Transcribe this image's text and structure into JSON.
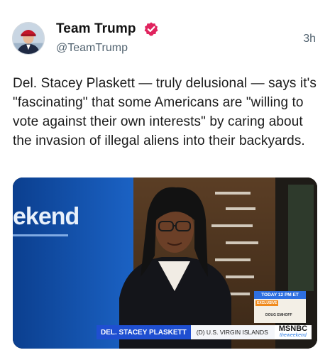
{
  "post": {
    "display_name": "Team Trump",
    "handle": "@TeamTrump",
    "timestamp": "3h",
    "body": "Del. Stacey Plaskett — truly delusional — says it's \"fascinating\" that some Americans are \"willing to vote against their own interests\" by caring about the invasion of illegal aliens into their backyards.",
    "verified_icon": "verified-badge-icon"
  },
  "media": {
    "background_wordmark": "ekend",
    "lower_third": {
      "name": "DEL. STACEY PLASKETT",
      "subtitle": "(D) U.S. VIRGIN ISLANDS",
      "network": "MSNBC",
      "network_tag": "theweekend"
    },
    "promo": {
      "header": "TODAY 12 PM ET",
      "badge": "EXCLUSIVE",
      "guest": "DOUG EMHOFF"
    }
  },
  "colors": {
    "verified": "#e0245e",
    "lower_third_blue": "#1f4fd1",
    "promo_blue": "#2e6fe0"
  }
}
